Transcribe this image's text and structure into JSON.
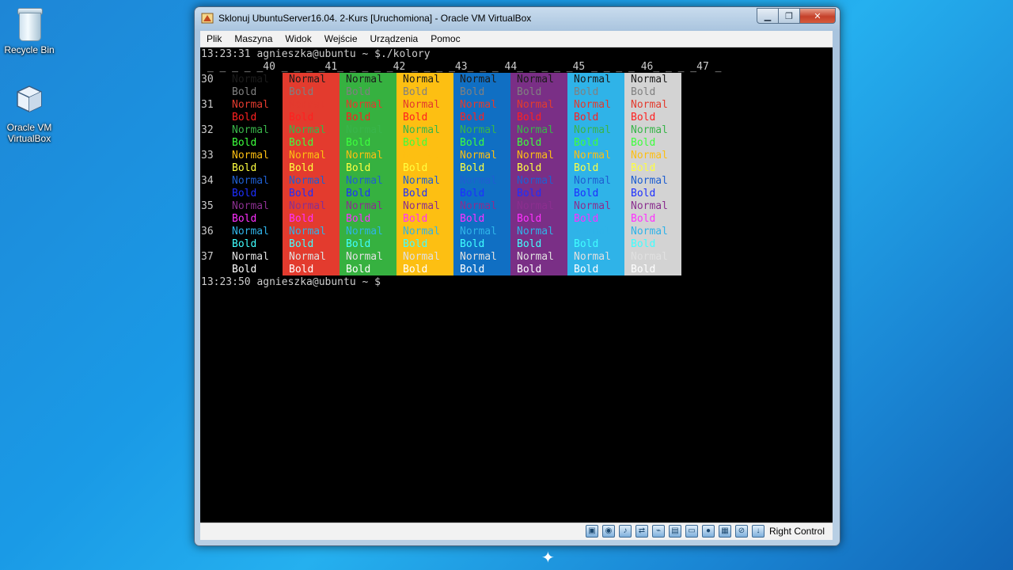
{
  "desktop": {
    "recycle_bin_label": "Recycle Bin",
    "vbox_label_line1": "Oracle VM",
    "vbox_label_line2": "VirtualBox"
  },
  "window": {
    "title": "Sklonuj UbuntuServer16.04. 2-Kurs [Uruchomiona] - Oracle VM VirtualBox",
    "min_icon": "▁",
    "max_icon": "❐",
    "close_icon": "✕"
  },
  "menu": {
    "items": [
      "Plik",
      "Maszyna",
      "Widok",
      "Wejście",
      "Urządzenia",
      "Pomoc"
    ]
  },
  "terminal": {
    "prompt1": "13:23:31 agnieszka@ubuntu ~ $./kolory",
    "header": " _ _ _ _ _40 _ _ _ _41_ _ _ _ _42 _ _ _ _43_ _ _ 44_ _ _ _ _45 _ _ _ _ 46_ _ _ _47 _",
    "prompt2": "13:23:50 agnieszka@ubuntu ~ $",
    "fg_codes": [
      "30",
      "31",
      "32",
      "33",
      "34",
      "35",
      "36",
      "37"
    ],
    "normal_word": "Normal",
    "bold_word": "Bold",
    "bg_colors": [
      "#e33b2e",
      "#36b140",
      "#fdbf12",
      "#106fc3",
      "#7a2f86",
      "#2fb3e8",
      "#d3d3d3"
    ],
    "fg_normal": [
      "#1b1b1b",
      "#e33b2e",
      "#39b54a",
      "#fdbf12",
      "#1f5fd1",
      "#8b2f8f",
      "#2fb3e8",
      "#e0e0e0"
    ],
    "fg_bold": [
      "#808080",
      "#ff2020",
      "#3dff3d",
      "#ffff40",
      "#1d2fff",
      "#ff30ff",
      "#40ffff",
      "#ffffff"
    ]
  },
  "status": {
    "host_key": "Right Control"
  },
  "colors": {
    "terminal_bg": "#000000",
    "prompt_fg": "#cccccc"
  }
}
